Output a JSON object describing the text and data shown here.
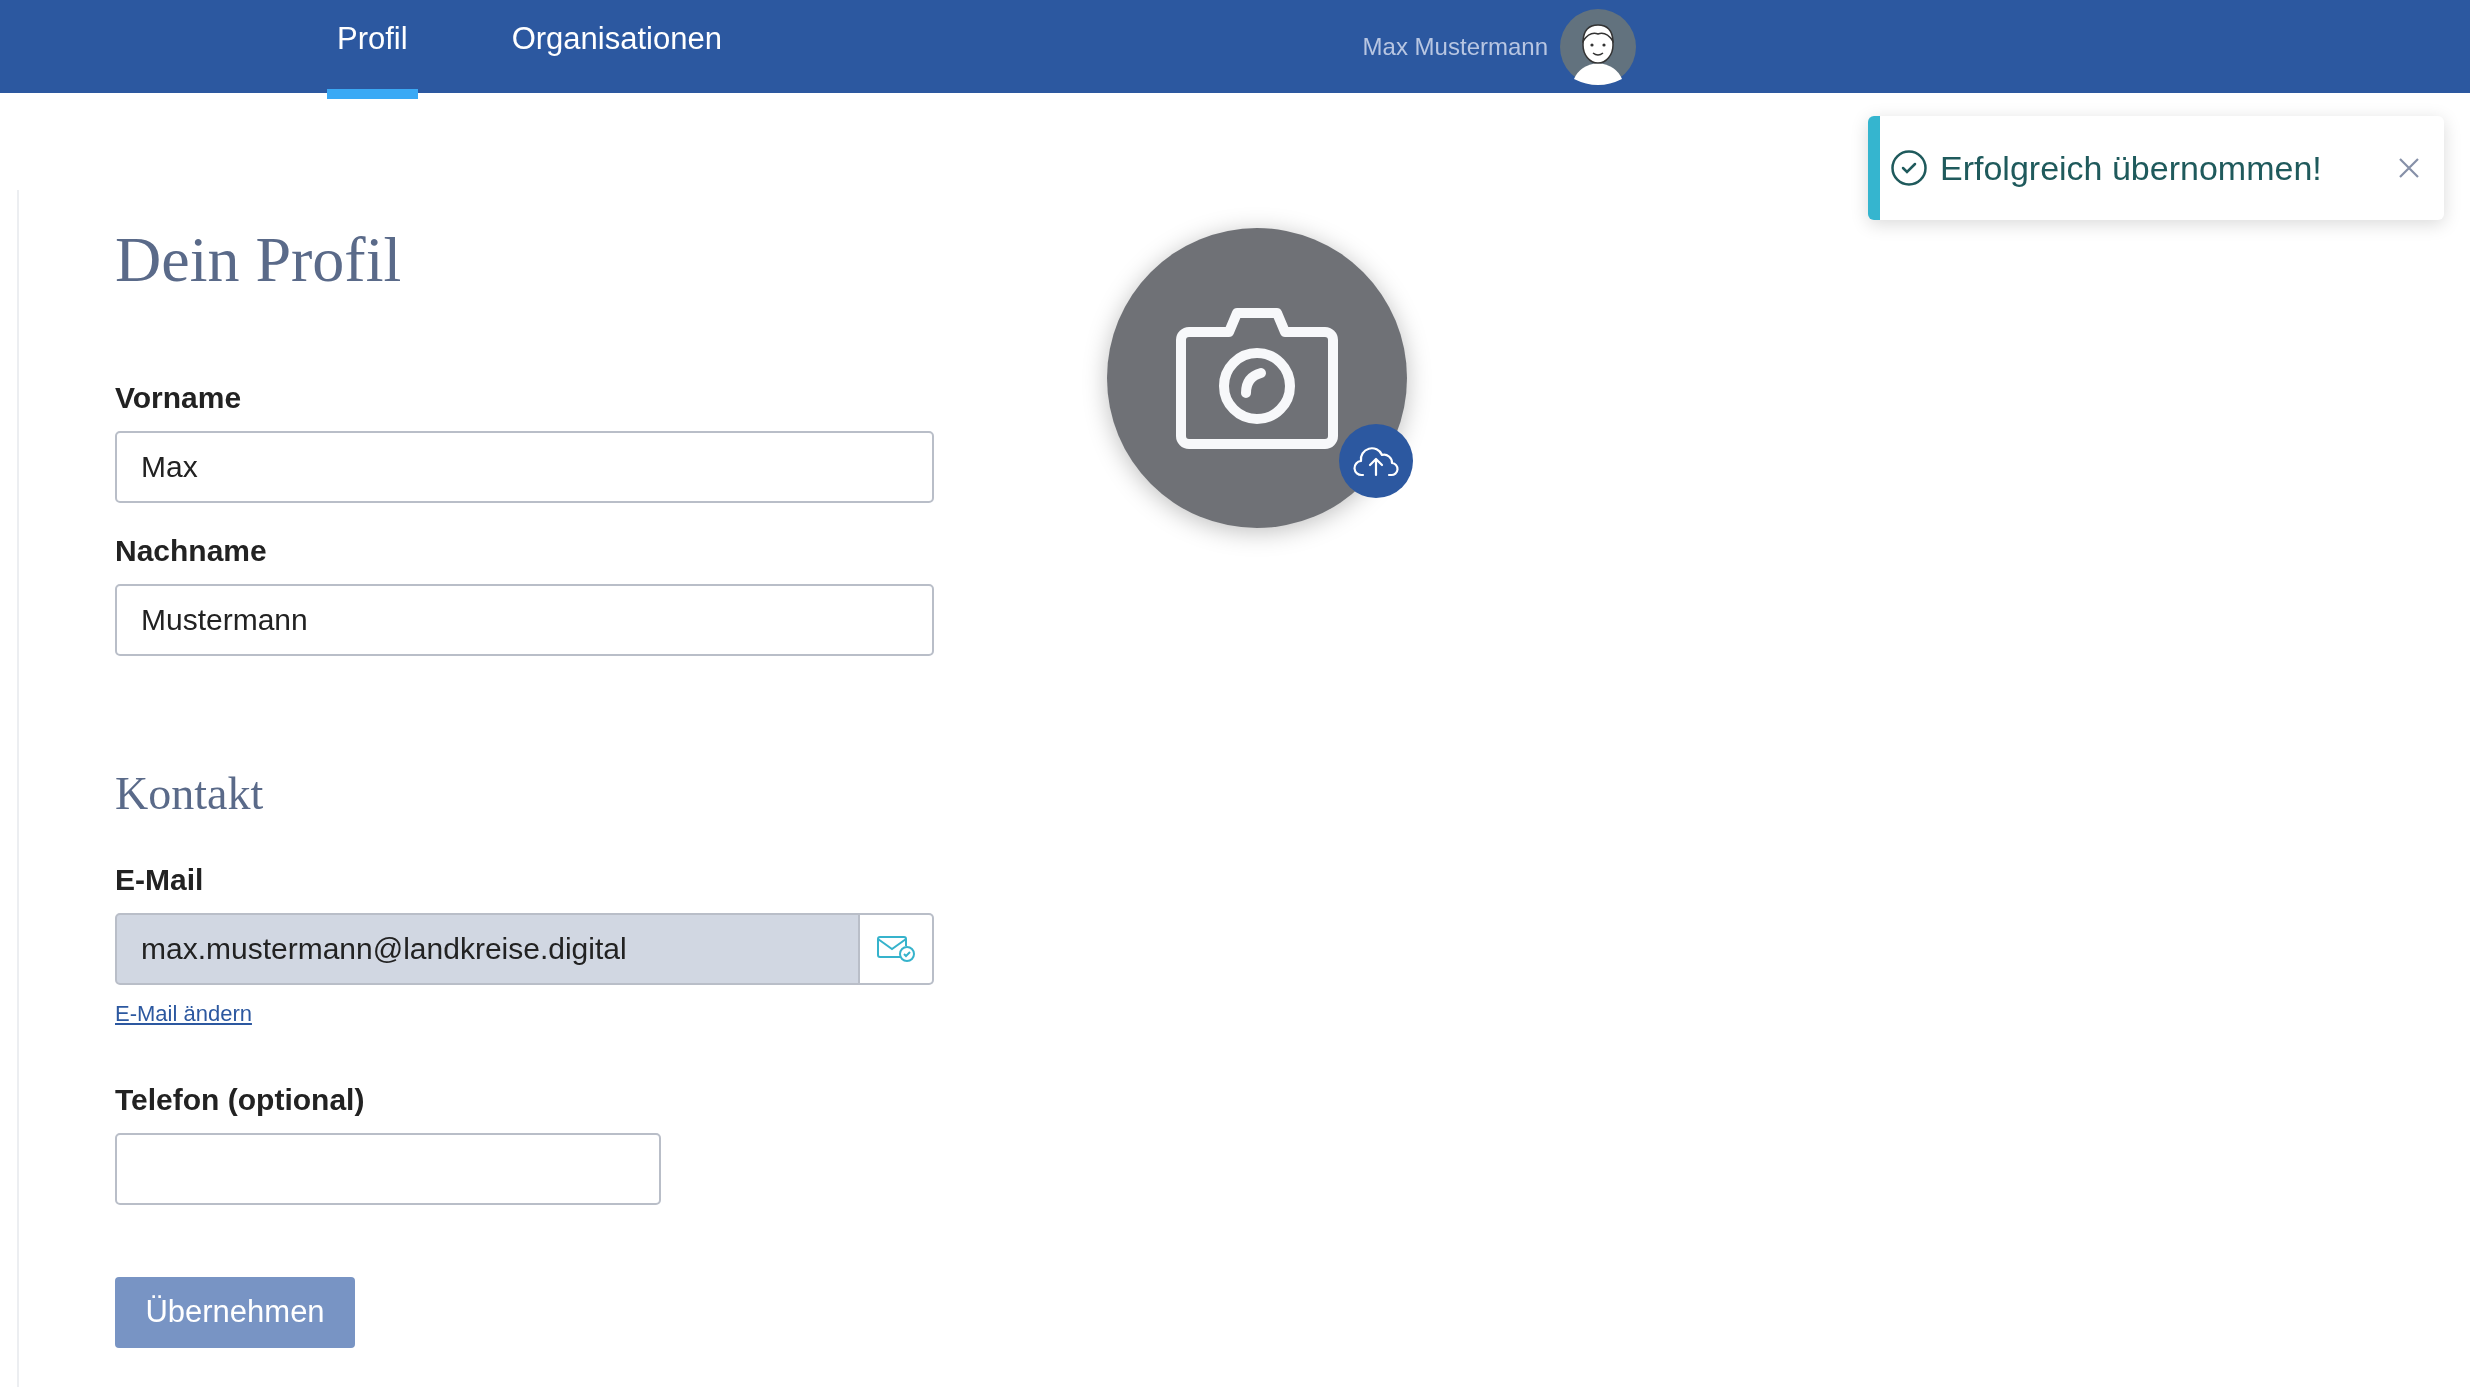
{
  "nav": {
    "tabs": [
      {
        "label": "Profil",
        "selected": true
      },
      {
        "label": "Organisationen",
        "selected": false
      }
    ],
    "user": {
      "name": "Max Mustermann"
    }
  },
  "toast": {
    "kind": "success",
    "message": "Erfolgreich übernommen!"
  },
  "profile": {
    "title": "Dein Profil",
    "fields": [
      {
        "label": "Vorname",
        "value": "Max",
        "readonly": false,
        "wide": true
      },
      {
        "label": "Nachname",
        "value": "Mustermann",
        "readonly": false,
        "wide": true
      }
    ],
    "contact_title": "Kontakt",
    "email": {
      "label": "E-Mail",
      "value": "max.mustermann@landkreise.digital",
      "readonly": true,
      "verified": true,
      "link": "E-Mail ändern"
    },
    "phone": {
      "label": "Telefon (optional)",
      "readonly": false,
      "wide": false
    },
    "submit": {
      "label": "Übernehmen",
      "disabled": true
    }
  }
}
